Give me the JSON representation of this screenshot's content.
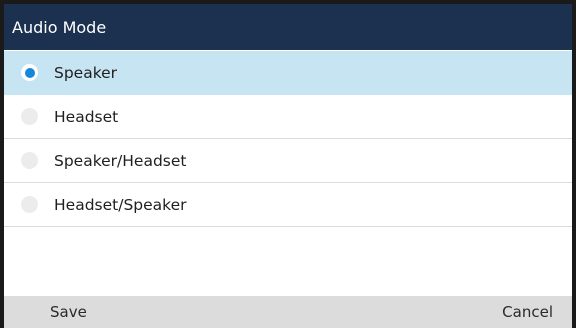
{
  "window": {
    "title": "Audio Mode"
  },
  "options": [
    {
      "label": "Speaker",
      "selected": true
    },
    {
      "label": "Headset",
      "selected": false
    },
    {
      "label": "Speaker/Headset",
      "selected": false
    },
    {
      "label": "Headset/Speaker",
      "selected": false
    }
  ],
  "softkeys": {
    "left": "Save",
    "right": "Cancel"
  },
  "colors": {
    "title_bar": "#1c3050",
    "selected_row": "#c6e4f2",
    "radio_selected": "#1588d9",
    "softkey_bar": "#dcdcdc"
  }
}
